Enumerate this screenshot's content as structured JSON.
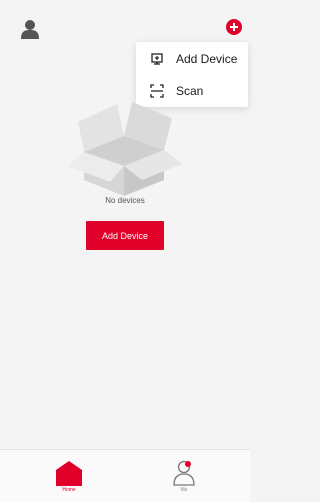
{
  "colors": {
    "accent": "#e0002a",
    "background": "#f4f4f4",
    "text": "#1a1a1a",
    "muted": "#888888"
  },
  "top_bar": {
    "profile_icon": "person-icon",
    "add_icon": "plus-circle-icon"
  },
  "menu": {
    "items": [
      {
        "label": "Add Device",
        "icon": "device-add-icon"
      },
      {
        "label": "Scan",
        "icon": "scan-icon"
      }
    ]
  },
  "empty_state": {
    "illustration": "open-box-icon",
    "message": "No devices",
    "button_label": "Add Device"
  },
  "bottom_nav": {
    "items": [
      {
        "label": "Home",
        "icon": "home-icon",
        "active": true
      },
      {
        "label": "Me",
        "icon": "profile-icon",
        "active": false,
        "badge_dot": true
      }
    ]
  }
}
